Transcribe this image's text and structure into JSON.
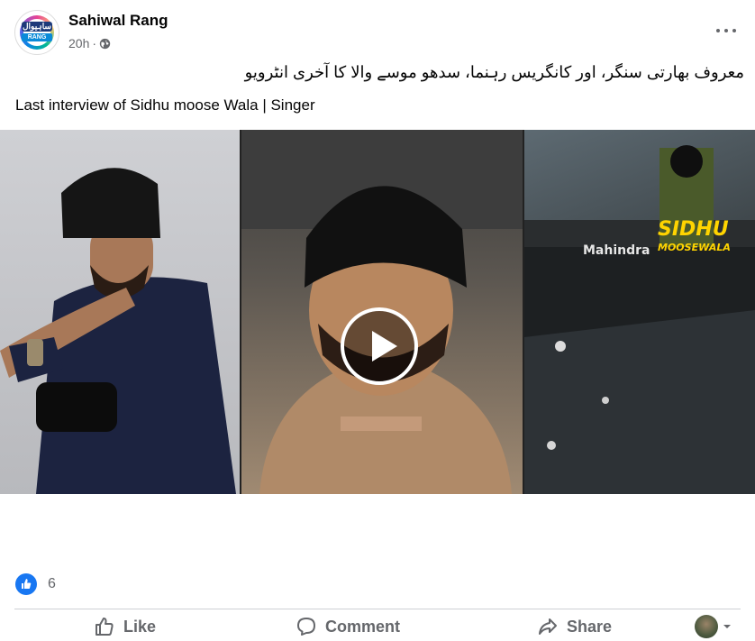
{
  "post": {
    "page_name": "Sahiwal Rang",
    "avatar_text_urdu": "ساہیوال",
    "avatar_text_en": "RANG",
    "time": "20h",
    "separator": "·",
    "audience_icon": "globe-icon",
    "menu_icon": "more-options-icon",
    "caption_urdu": "معروف بھارتی سنگر، اور کانگریس رہنما، سدھو موسے والا کا آخری انٹرویو",
    "caption_en": "Last interview of Sidhu moose Wala | Singer"
  },
  "media": {
    "thumbnail_text": {
      "brand": "Mahindra",
      "title_line1": "SIDHU",
      "title_line2": "MOOSEWALA"
    },
    "play_icon": "play-icon"
  },
  "reactions": {
    "icon": "like-reaction-icon",
    "count": "6"
  },
  "actions": {
    "like": "Like",
    "comment": "Comment",
    "share": "Share"
  },
  "colors": {
    "accent": "#1877f2",
    "secondary_text": "#65676b",
    "divider": "#ced0d4"
  }
}
